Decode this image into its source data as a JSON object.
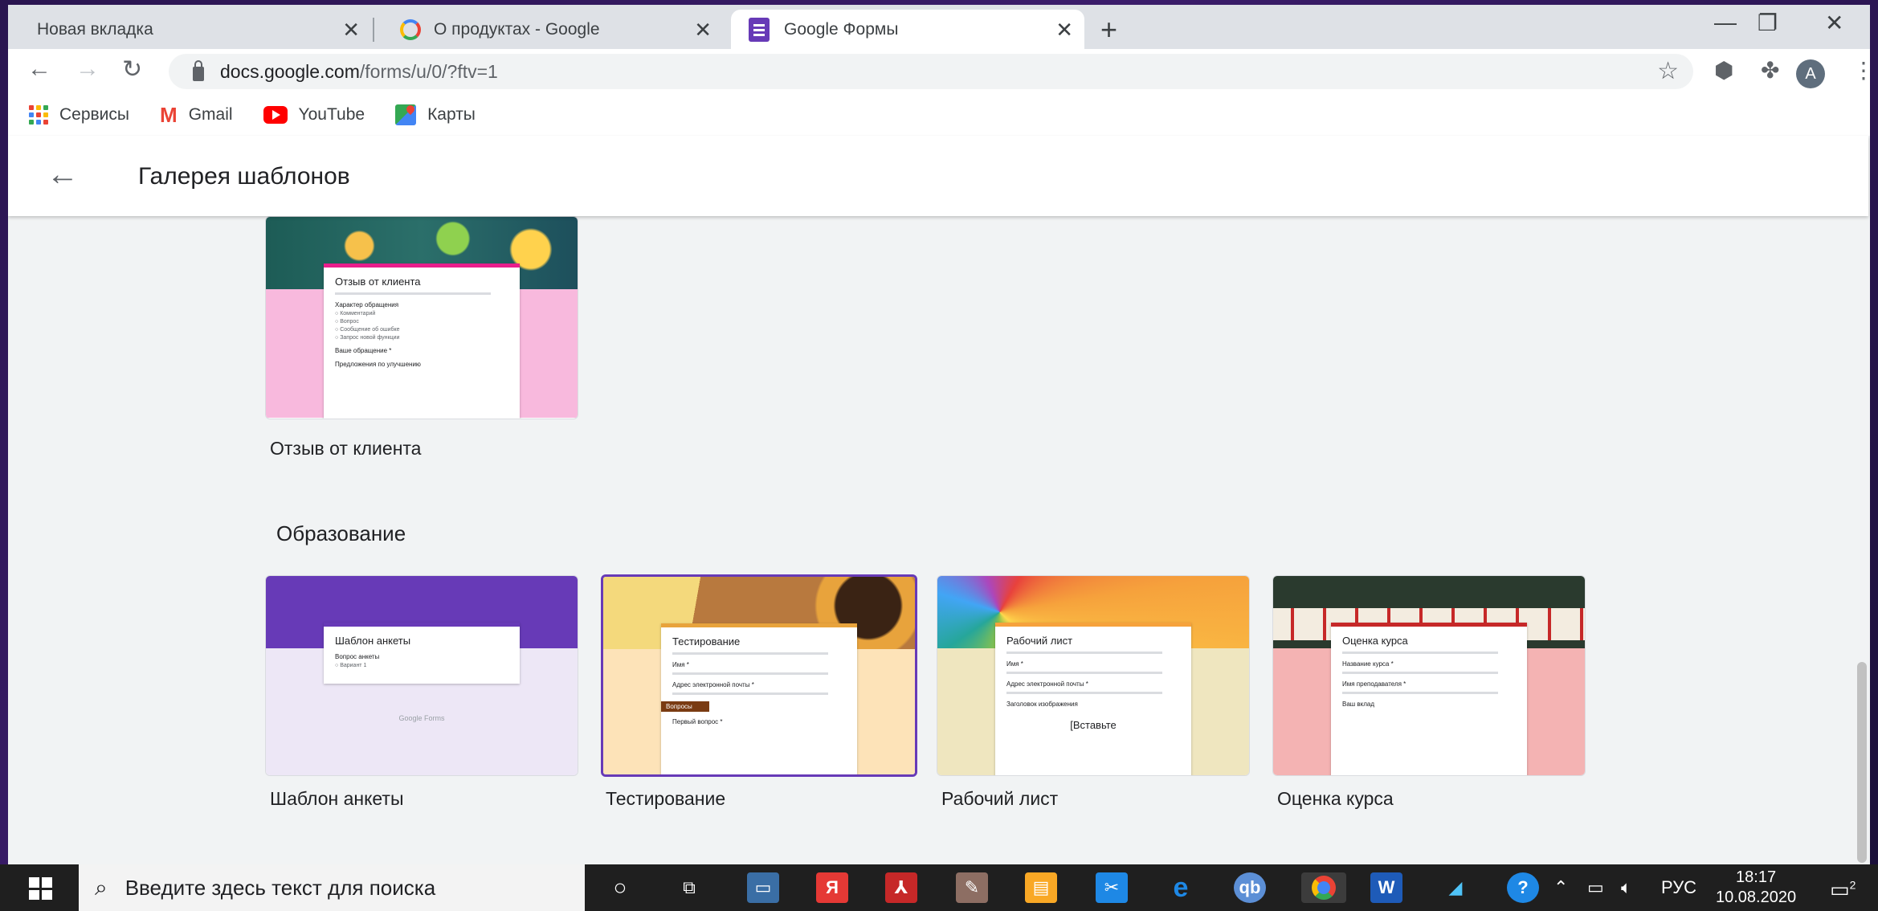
{
  "tabs": [
    {
      "title": "Новая вкладка",
      "active": false
    },
    {
      "title": "О продуктах - Google",
      "active": false
    },
    {
      "title": "Google Формы",
      "active": true
    }
  ],
  "toolbar": {
    "url_host": "docs.google.com",
    "url_path": "/forms/u/0/?ftv=1",
    "avatar_letter": "A"
  },
  "bookmarks": [
    {
      "label": "Сервисы",
      "icon": "apps-grid-icon"
    },
    {
      "label": "Gmail",
      "icon": "gmail-icon"
    },
    {
      "label": "YouTube",
      "icon": "youtube-icon"
    },
    {
      "label": "Карты",
      "icon": "maps-icon"
    }
  ],
  "header": {
    "title": "Галерея шаблонов"
  },
  "templates_top": [
    {
      "label": "Отзыв от клиента",
      "sheet_title": "Отзыв от клиента",
      "sheet_q1": "Характер обращения",
      "sheet_opts": [
        "Комментарий",
        "Вопрос",
        "Сообщение об ошибке",
        "Запрос новой функции"
      ],
      "sheet_q2": "Ваше обращение *",
      "sheet_q3": "Предложения по улучшению"
    }
  ],
  "education": {
    "section_title": "Образование",
    "templates": [
      {
        "label": "Шаблон анкеты",
        "sheet_title": "Шаблон анкеты",
        "sheet_q1": "Вопрос анкеты",
        "sheet_opts": [
          "Вариант 1"
        ],
        "footer": "Google Forms"
      },
      {
        "label": "Тестирование",
        "sheet_title": "Тестирование",
        "sheet_q1": "Имя *",
        "sheet_q2": "Адрес электронной почты *",
        "sheet_band": "Вопросы",
        "sheet_q3": "Первый вопрос *",
        "selected": true
      },
      {
        "label": "Рабочий лист",
        "sheet_title": "Рабочий лист",
        "sheet_q1": "Имя *",
        "sheet_q2": "Адрес электронной почты *",
        "sheet_q3": "Заголовок изображения",
        "sheet_q4": "[Вставьте"
      },
      {
        "label": "Оценка курса",
        "sheet_title": "Оценка курса",
        "sheet_q1": "Название курса *",
        "sheet_q2": "Имя преподавателя *",
        "sheet_q3": "Ваш вклад"
      }
    ]
  },
  "taskbar": {
    "search_placeholder": "Введите здесь текст для поиска",
    "lang": "РУС",
    "time": "18:17",
    "date": "10.08.2020",
    "notification_count": "2"
  },
  "colors": {
    "forms_purple": "#673ab7",
    "chrome_tab_bg": "#dee1e6",
    "page_bg": "#f1f3f4"
  }
}
